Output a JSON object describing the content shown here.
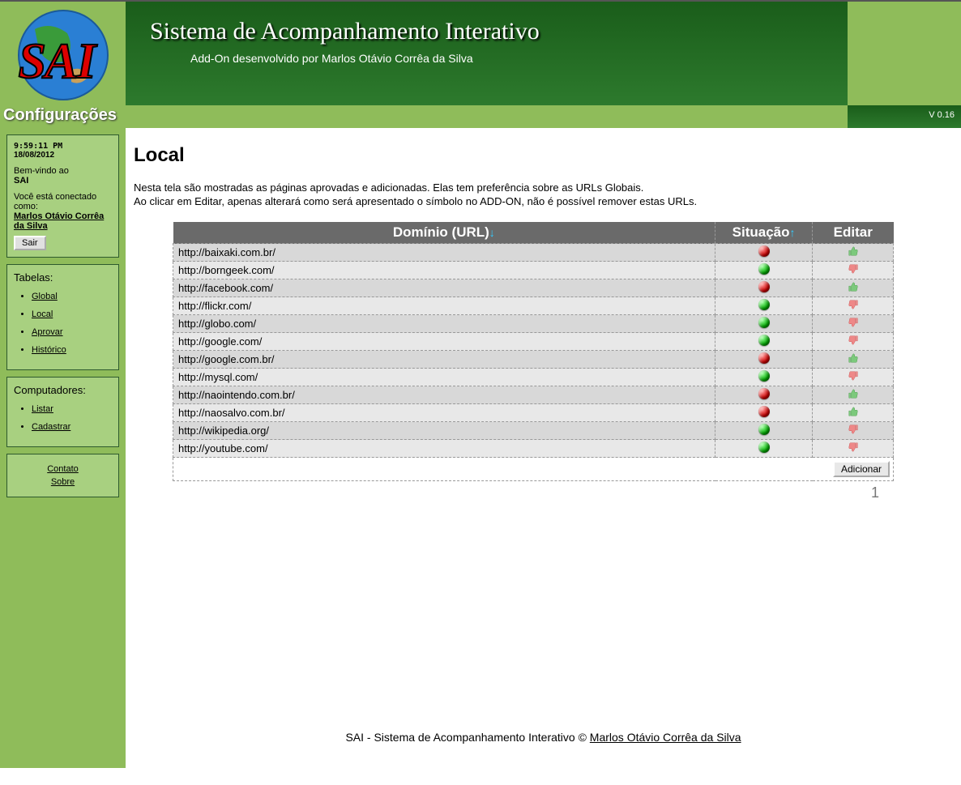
{
  "header": {
    "title": "Sistema de Acompanhamento Interativo",
    "subtitle": "Add-On desenvolvido por Marlos Otávio Corrêa da Silva",
    "version": "V 0.16",
    "logo_text": "SAI",
    "subheader": "Configurações"
  },
  "sidebar": {
    "info": {
      "time": "9:59:11 PM",
      "date": "18/08/2012",
      "welcome_prefix": "Bem-vindo ao",
      "app_name": "SAI",
      "connected_as": "Você está conectado como:",
      "username": "Marlos Otávio Corrêa da Silva",
      "logout": "Sair"
    },
    "tables": {
      "title": "Tabelas:",
      "items": [
        "Global",
        "Local",
        "Aprovar",
        "Histórico"
      ]
    },
    "computers": {
      "title": "Computadores:",
      "items": [
        "Listar",
        "Cadastrar"
      ]
    },
    "links": {
      "contact": "Contato",
      "about": "Sobre"
    }
  },
  "main": {
    "title": "Local",
    "desc1": "Nesta tela são mostradas as páginas aprovadas e adicionadas. Elas tem preferência sobre as URLs Globais.",
    "desc2": "Ao clicar em Editar, apenas alterará como será apresentado o símbolo no ADD-ON, não é possível remover estas URLs.",
    "columns": {
      "url": "Domínio (URL)",
      "status": "Situação",
      "edit": "Editar"
    },
    "rows": [
      {
        "url": "http://baixaki.com.br/",
        "status": "red",
        "edit": "up"
      },
      {
        "url": "http://borngeek.com/",
        "status": "green",
        "edit": "down"
      },
      {
        "url": "http://facebook.com/",
        "status": "red",
        "edit": "up"
      },
      {
        "url": "http://flickr.com/",
        "status": "green",
        "edit": "down"
      },
      {
        "url": "http://globo.com/",
        "status": "green",
        "edit": "down"
      },
      {
        "url": "http://google.com/",
        "status": "green",
        "edit": "down"
      },
      {
        "url": "http://google.com.br/",
        "status": "red",
        "edit": "up"
      },
      {
        "url": "http://mysql.com/",
        "status": "green",
        "edit": "down"
      },
      {
        "url": "http://naointendo.com.br/",
        "status": "red",
        "edit": "up"
      },
      {
        "url": "http://naosalvo.com.br/",
        "status": "red",
        "edit": "up"
      },
      {
        "url": "http://wikipedia.org/",
        "status": "green",
        "edit": "down"
      },
      {
        "url": "http://youtube.com/",
        "status": "green",
        "edit": "down"
      }
    ],
    "add_button": "Adicionar",
    "page_number": "1"
  },
  "footer": {
    "prefix": "SAI - Sistema de Acompanhamento Interativo © ",
    "author": "Marlos Otávio Corrêa da Silva"
  }
}
